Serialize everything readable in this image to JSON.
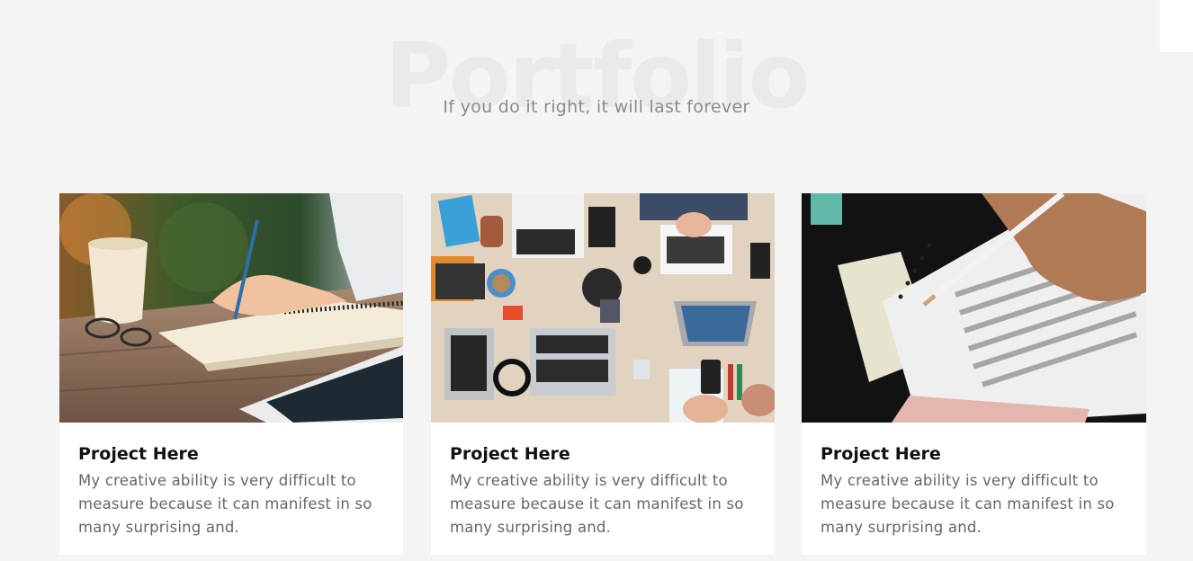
{
  "section": {
    "title": "Portfolio",
    "subtitle": "If you do it right, it will last forever"
  },
  "projects": [
    {
      "title": "Project Here",
      "description": "My creative ability is very difficult to measure because it can manifest in so many surprising and.",
      "image": "writing-notebook-photo"
    },
    {
      "title": "Project Here",
      "description": "My creative ability is very difficult to measure because it can manifest in so many surprising and.",
      "image": "team-laptops-desk-photo"
    },
    {
      "title": "Project Here",
      "description": "My creative ability is very difficult to measure because it can manifest in so many surprising and.",
      "image": "exam-answer-sheet-photo"
    }
  ]
}
